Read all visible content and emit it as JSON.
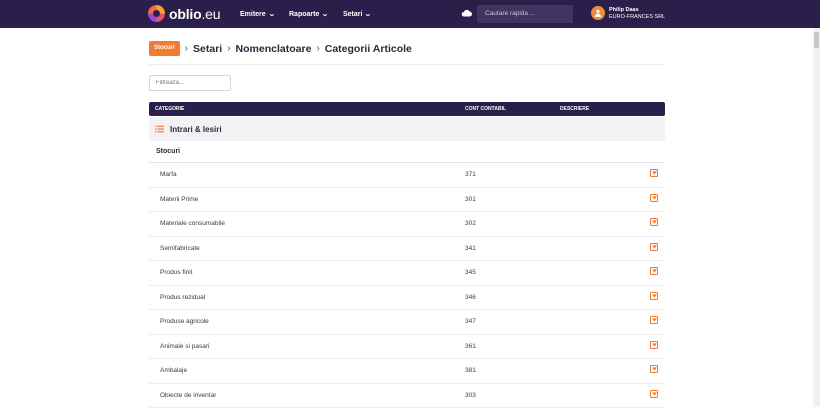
{
  "header": {
    "logo_main": "oblio",
    "logo_suffix": ".eu",
    "nav": [
      {
        "label": "Emitere",
        "icon": "chevron-down-icon"
      },
      {
        "label": "Rapoarte",
        "icon": "chevron-down-icon"
      },
      {
        "label": "Setari",
        "icon": "chevron-down-icon"
      }
    ],
    "search_placeholder": "Cautare rapida ...",
    "user_name": "Philip Daas",
    "company": "EURO-FRANCES SRL",
    "accent_color": "#f07d2f",
    "bar_color": "#2a1e4a"
  },
  "breadcrumb": {
    "badge": "Stocuri",
    "items": [
      "Setari",
      "Nomenclatoare",
      "Categorii Articole"
    ]
  },
  "filter": {
    "placeholder": "Filtreaza..."
  },
  "table": {
    "headers": {
      "category": "CATEGORIE",
      "account": "CONT CONTABIL",
      "description": "DESCRIERE"
    },
    "group_title": "Intrari & Iesiri",
    "subgroup": "Stocuri",
    "rows": [
      {
        "name": "Marfa",
        "account": "371"
      },
      {
        "name": "Materii Prime",
        "account": "301"
      },
      {
        "name": "Materiale consumabile",
        "account": "302"
      },
      {
        "name": "Semifabricate",
        "account": "341"
      },
      {
        "name": "Produs finit",
        "account": "345"
      },
      {
        "name": "Produs rezidual",
        "account": "346"
      },
      {
        "name": "Produse agricole",
        "account": "347"
      },
      {
        "name": "Animale si pasari",
        "account": "361"
      },
      {
        "name": "Ambalaje",
        "account": "381"
      },
      {
        "name": "Obiecte de inventar",
        "account": "303"
      }
    ]
  }
}
